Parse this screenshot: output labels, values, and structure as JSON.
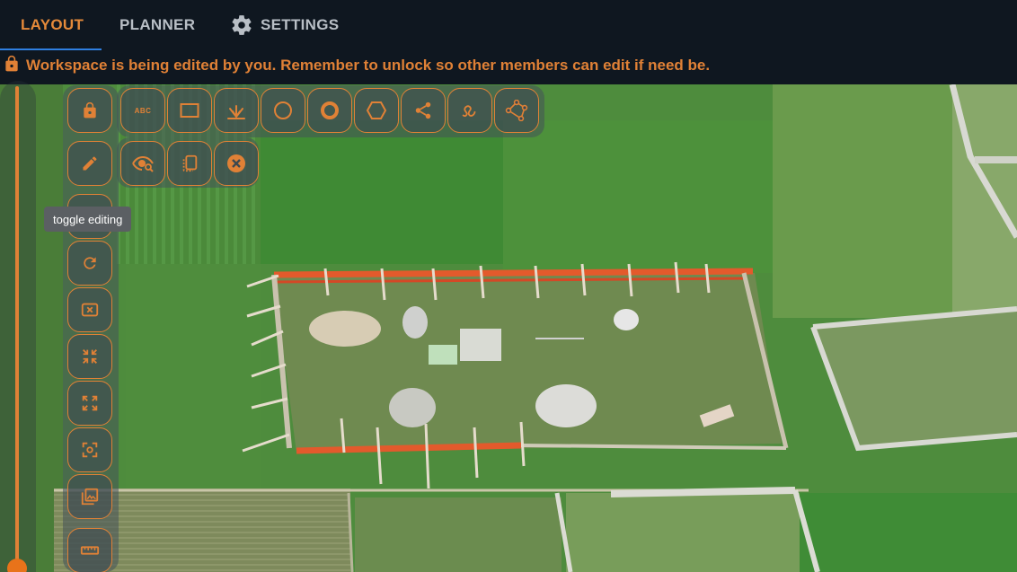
{
  "nav": {
    "tabs": [
      {
        "label": "LAYOUT",
        "active": true
      },
      {
        "label": "PLANNER",
        "active": false
      },
      {
        "label": "SETTINGS",
        "active": false,
        "icon": "gear-icon"
      }
    ]
  },
  "banner": {
    "icon": "lock-icon",
    "text": "Workspace is being edited by you. Remember to unlock so other members can edit if need be."
  },
  "toolbar": {
    "text_tool_label": "ABC",
    "tooltip": "toggle editing",
    "row1_tools": [
      "text-tool",
      "rectangle-tool",
      "explode-tool",
      "circle-tool",
      "ring-tool",
      "hexagon-tool",
      "connector-tool",
      "freehand-tool",
      "polygon-tool"
    ],
    "row2_tools": [
      "visibility-tool",
      "duplicate-tool",
      "delete-tool"
    ],
    "side_tools": [
      "lock-button",
      "edit-button",
      "toggle-editing-button",
      "rotate-button",
      "clear-button",
      "collapse-button",
      "expand-button",
      "focus-button",
      "layers-button",
      "measure-button"
    ]
  },
  "colors": {
    "accent": "#e08136",
    "nav_bg": "#0f1720",
    "active_underline": "#2f7fe0"
  }
}
